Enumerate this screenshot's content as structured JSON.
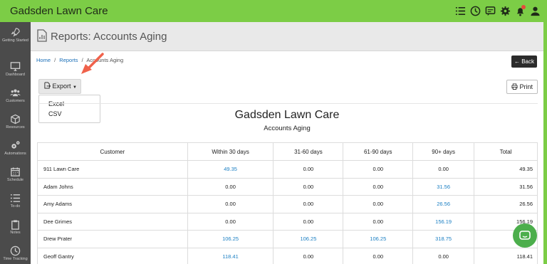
{
  "app": {
    "brand": "Gadsden Lawn Care"
  },
  "sidebar": {
    "items": [
      {
        "label": "Getting Started",
        "icon": "rocket-icon"
      },
      {
        "label": "Dashboard",
        "icon": "monitor-icon"
      },
      {
        "label": "Customers",
        "icon": "users-icon"
      },
      {
        "label": "Resources",
        "icon": "box-icon"
      },
      {
        "label": "Automations",
        "icon": "gears-icon"
      },
      {
        "label": "Schedule",
        "icon": "calendar-icon"
      },
      {
        "label": "To-do",
        "icon": "checklist-icon"
      },
      {
        "label": "Notes",
        "icon": "clipboard-icon"
      },
      {
        "label": "Time Tracking",
        "icon": "clock-icon"
      }
    ]
  },
  "header": {
    "title": "Reports: Accounts Aging"
  },
  "breadcrumb": {
    "home": "Home",
    "reports": "Reports",
    "current": "Accounts Aging",
    "sep": "/"
  },
  "toolbar": {
    "back_label": "← Back",
    "export_label": "Export",
    "print_label": "Print",
    "export_options": [
      "Excel",
      "CSV"
    ]
  },
  "report": {
    "company": "Gadsden Lawn Care",
    "subtitle": "Accounts Aging"
  },
  "table": {
    "headers": [
      "Customer",
      "Within 30 days",
      "31-60 days",
      "61-90 days",
      "90+ days",
      "Total"
    ],
    "rows": [
      {
        "customer": "911 Lawn Care",
        "c30": "49.35",
        "c60": "0.00",
        "c90": "0.00",
        "c90p": "0.00",
        "total": "49.35"
      },
      {
        "customer": "Adam Johns",
        "c30": "0.00",
        "c60": "0.00",
        "c90": "0.00",
        "c90p": "31.56",
        "total": "31.56"
      },
      {
        "customer": "Amy Adams",
        "c30": "0.00",
        "c60": "0.00",
        "c90": "0.00",
        "c90p": "26.56",
        "total": "26.56"
      },
      {
        "customer": "Dee Grimes",
        "c30": "0.00",
        "c60": "0.00",
        "c90": "0.00",
        "c90p": "156.19",
        "total": "156.19"
      },
      {
        "customer": "Drew Prater",
        "c30": "106.25",
        "c60": "106.25",
        "c90": "106.25",
        "c90p": "318.75",
        "total": ""
      },
      {
        "customer": "Geoff Gantry",
        "c30": "118.41",
        "c60": "0.00",
        "c90": "0.00",
        "c90p": "0.00",
        "total": "118.41"
      }
    ]
  },
  "colors": {
    "brand_green": "#7ccd46",
    "sidebar": "#4b4b4b",
    "link": "#1b7fc3",
    "arrow": "#f0624b",
    "chat": "#4cae4c"
  }
}
